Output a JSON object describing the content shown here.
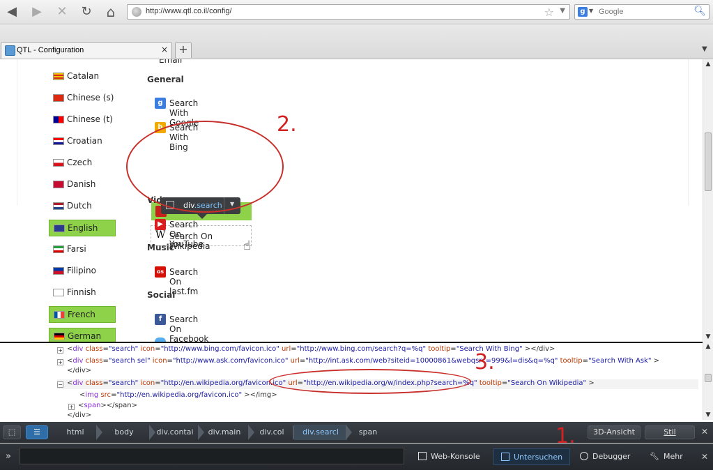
{
  "browser": {
    "nav": {
      "back": "◀",
      "forward": "▶",
      "stop": "✕",
      "reload": "↻",
      "home": "⌂"
    },
    "url": "http://www.qtl.co.il/config/",
    "search_placeholder": "Google",
    "tab_title": "QTL - Configuration",
    "tab_close": "×",
    "new_tab": "+",
    "tab_list": "▼"
  },
  "languages": [
    {
      "name": "Catalan",
      "flag": "catalan-flag",
      "selected": false
    },
    {
      "name": "Chinese (s)",
      "flag": "china-flag",
      "selected": false
    },
    {
      "name": "Chinese (t)",
      "flag": "taiwan-flag",
      "selected": false
    },
    {
      "name": "Croatian",
      "flag": "croatia-flag",
      "selected": false
    },
    {
      "name": "Czech",
      "flag": "czech-flag",
      "selected": false
    },
    {
      "name": "Danish",
      "flag": "denmark-flag",
      "selected": false
    },
    {
      "name": "Dutch",
      "flag": "netherlands-flag",
      "selected": false
    },
    {
      "name": "English",
      "flag": "uk-flag",
      "selected": true
    },
    {
      "name": "Farsi",
      "flag": "iran-flag",
      "selected": false
    },
    {
      "name": "Filipino",
      "flag": "philippines-flag",
      "selected": false
    },
    {
      "name": "Finnish",
      "flag": "finland-flag",
      "selected": false
    },
    {
      "name": "French",
      "flag": "france-flag",
      "selected": true
    },
    {
      "name": "German",
      "flag": "germany-flag",
      "selected": true
    }
  ],
  "sections": {
    "partial_top": "Email",
    "general": "General",
    "video": "Video",
    "music": "Music",
    "social": "Social"
  },
  "services": {
    "google": "Search With Google",
    "bing": "Search With Bing",
    "ask": "Search With Ask",
    "wikipedia": "Search On Wikipedia",
    "youtube": "Search On YouTube",
    "lastfm": "Search On last.fm",
    "facebook": "Search On Facebook"
  },
  "inspector_tooltip": {
    "tag": "div",
    "cls": ".search"
  },
  "annotations": {
    "one": "1.",
    "two": "2.",
    "three": "3."
  },
  "markup": {
    "l1": {
      "tag": "div",
      "class": "search",
      "icon": "http://www.bing.com/favicon.ico",
      "url": "http://www.bing.com/search?q=%q",
      "tooltip": "Search With Bing"
    },
    "l2": {
      "tag": "div",
      "class": "search sel",
      "icon": "http://www.ask.com/favicon.ico",
      "url": "http://int.ask.com/web?siteid=10000861&webqsrc=999&l=dis&q=%q",
      "tooltip": "Search With Ask"
    },
    "l2b": "</div>",
    "l3": {
      "tag": "div",
      "class": "search",
      "icon": "http://en.wikipedia.org/favicon.ico",
      "url": "http://en.wikipedia.org/w/index.php?search=%q",
      "tooltip": "Search On Wikipedia"
    },
    "l4": {
      "tag": "img",
      "src": "http://en.wikipedia.org/favicon.ico"
    },
    "l5": {
      "tag": "span"
    },
    "l6": "</div>"
  },
  "breadcrumbs": [
    "html",
    "body",
    "div.contai",
    "div.main",
    "div.col",
    "div.searcl",
    "span"
  ],
  "breadcrumb_active_index": 5,
  "buttons": {
    "view3d": "3D-Ansicht",
    "style": "Stil",
    "close": "✕"
  },
  "cmdbar": {
    "prompt": "»",
    "console": "Web-Konsole",
    "inspect": "Untersuchen",
    "debugger": "Debugger",
    "more": "Mehr",
    "close": "✕"
  },
  "colors": {
    "selected_green": "#8ed24a",
    "annotation_red": "#d32020",
    "devtools_dark": "#2b2f34",
    "highlight_blue": "#8fc8ff"
  }
}
